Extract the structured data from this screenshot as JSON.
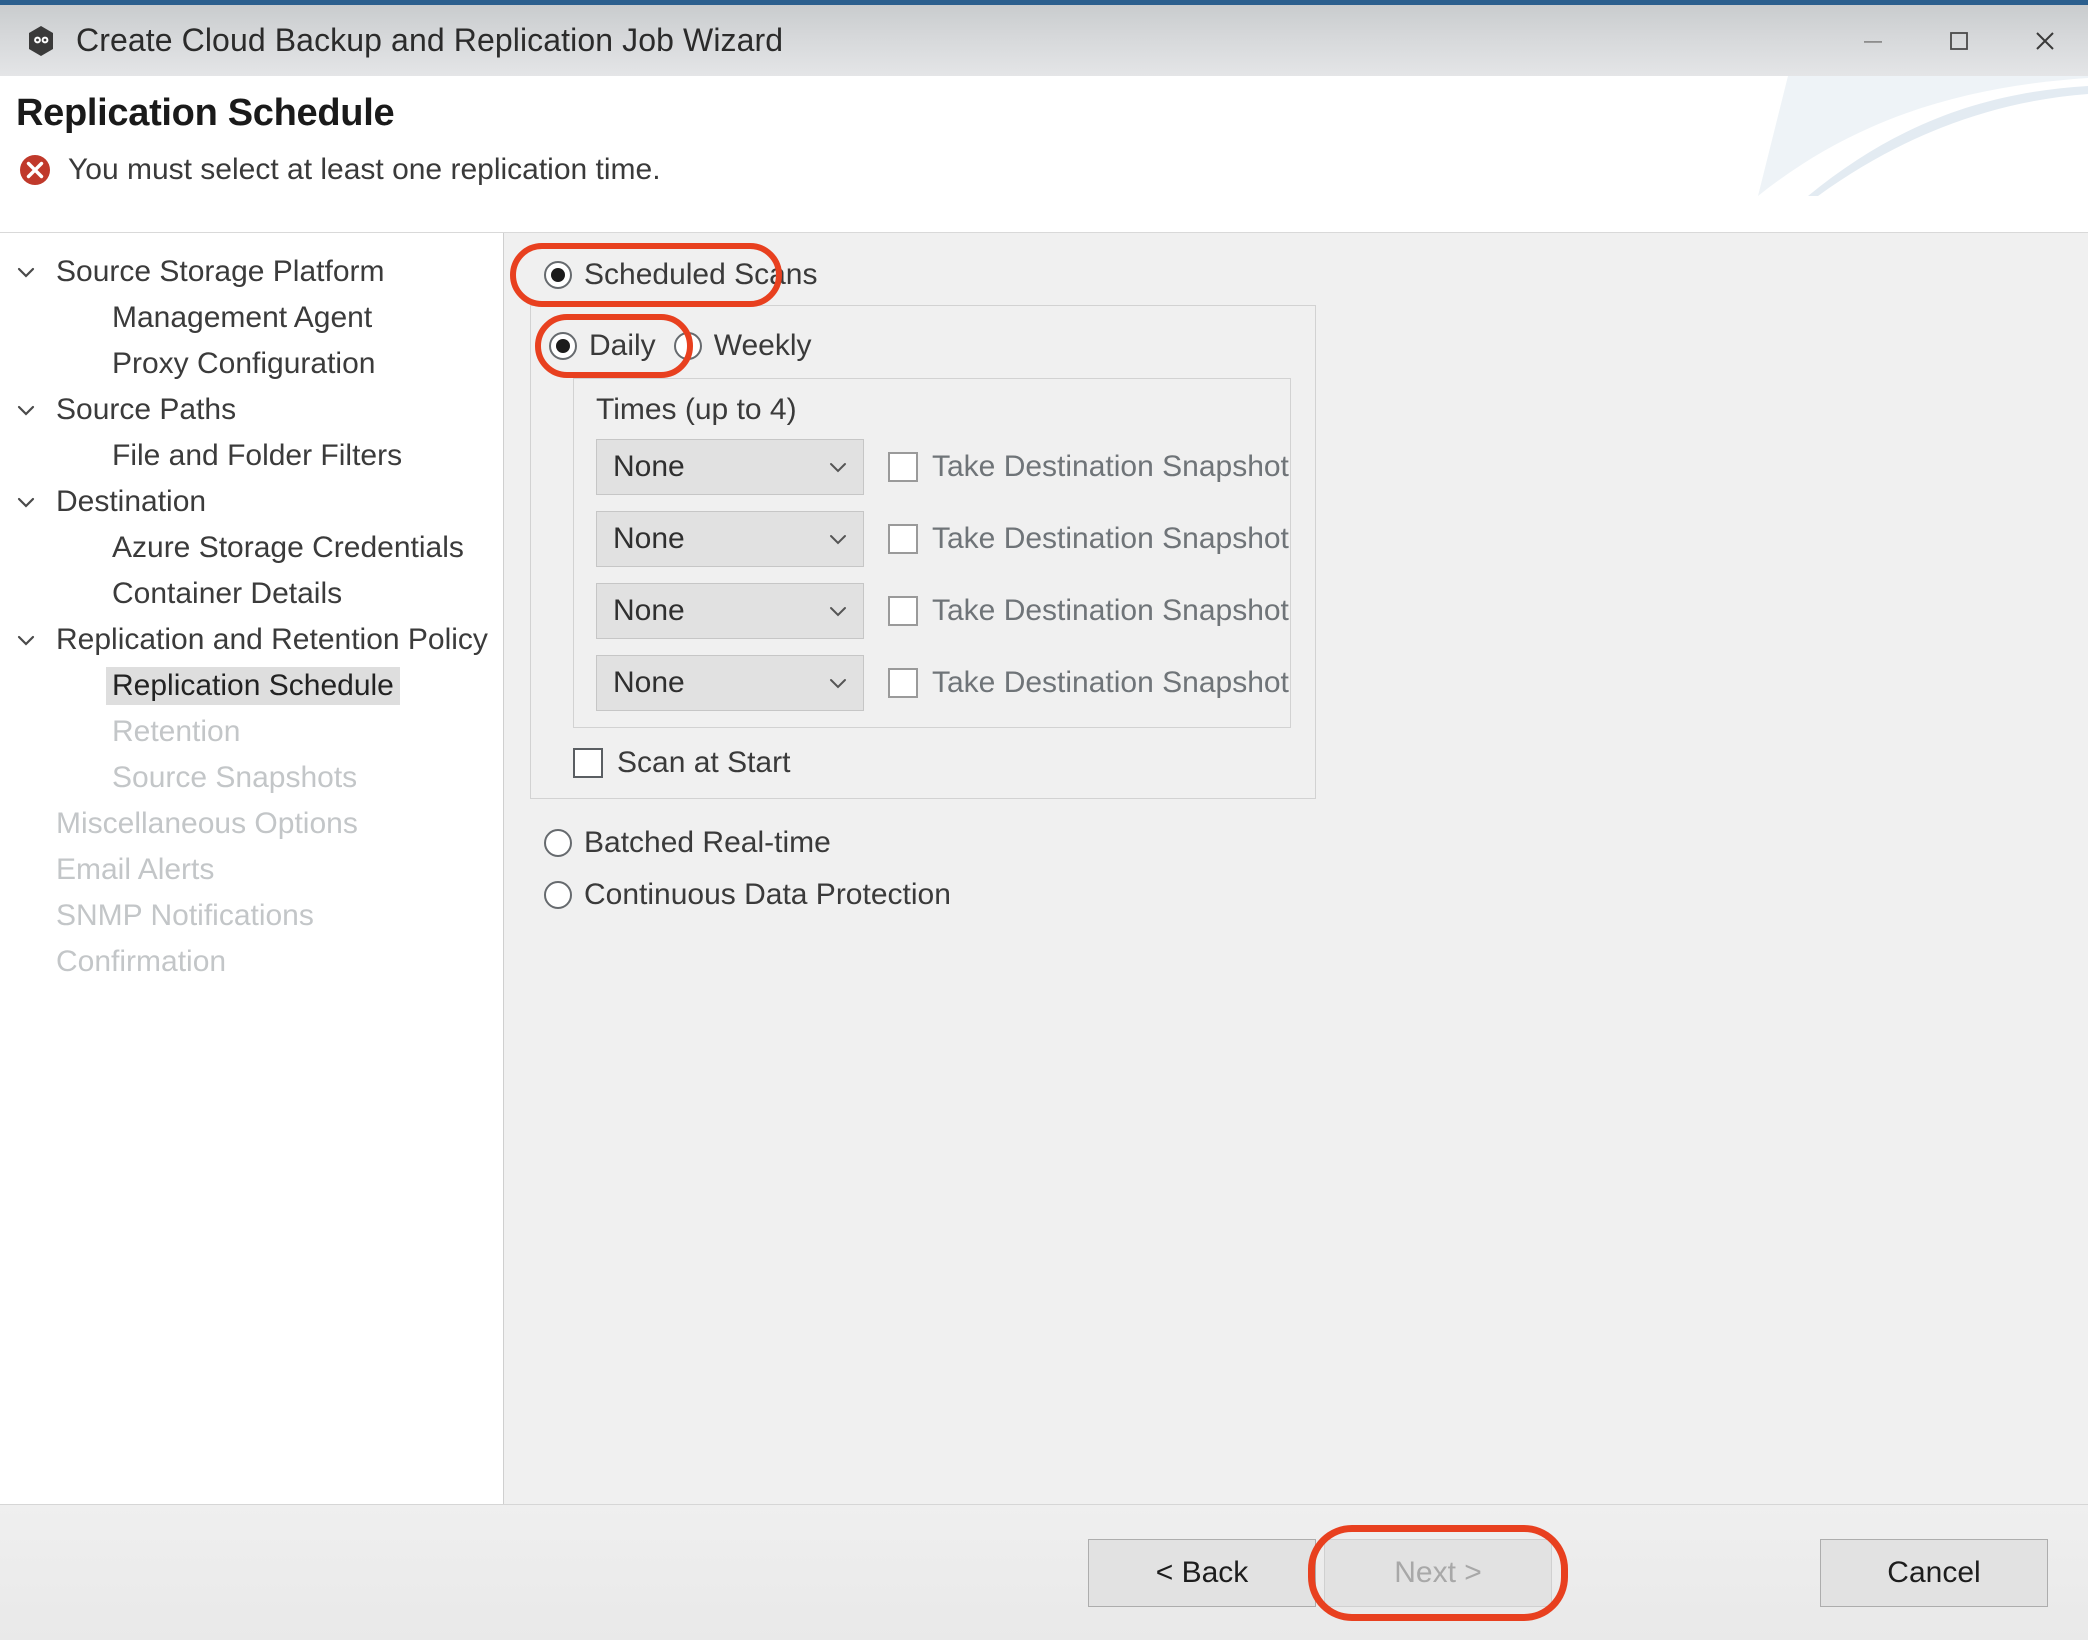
{
  "window": {
    "title": "Create Cloud Backup and Replication Job Wizard",
    "app_icon": "cloud-backup-icon",
    "controls": {
      "minimize": "minimize-icon",
      "maximize": "maximize-icon",
      "close": "close-icon"
    }
  },
  "header": {
    "page_title": "Replication Schedule",
    "error_icon": "error-circle-x-icon",
    "error_message": "You must select at least one replication time."
  },
  "sidebar": {
    "items": [
      {
        "label": "Source Storage Platform",
        "level": 0,
        "expandable": true,
        "state": "enabled"
      },
      {
        "label": "Management Agent",
        "level": 1,
        "expandable": false,
        "state": "enabled"
      },
      {
        "label": "Proxy Configuration",
        "level": 1,
        "expandable": false,
        "state": "enabled"
      },
      {
        "label": "Source Paths",
        "level": 0,
        "expandable": true,
        "state": "enabled"
      },
      {
        "label": "File and Folder Filters",
        "level": 1,
        "expandable": false,
        "state": "enabled"
      },
      {
        "label": "Destination",
        "level": 0,
        "expandable": true,
        "state": "enabled"
      },
      {
        "label": "Azure Storage Credentials",
        "level": 1,
        "expandable": false,
        "state": "enabled"
      },
      {
        "label": "Container Details",
        "level": 1,
        "expandable": false,
        "state": "enabled"
      },
      {
        "label": "Replication and Retention Policy",
        "level": 0,
        "expandable": true,
        "state": "enabled"
      },
      {
        "label": "Replication Schedule",
        "level": 1,
        "expandable": false,
        "state": "selected"
      },
      {
        "label": "Retention",
        "level": 1,
        "expandable": false,
        "state": "disabled"
      },
      {
        "label": "Source Snapshots",
        "level": 1,
        "expandable": false,
        "state": "disabled"
      },
      {
        "label": "Miscellaneous Options",
        "level": 0,
        "expandable": false,
        "state": "disabled"
      },
      {
        "label": "Email Alerts",
        "level": 0,
        "expandable": false,
        "state": "disabled"
      },
      {
        "label": "SNMP Notifications",
        "level": 0,
        "expandable": false,
        "state": "disabled"
      },
      {
        "label": "Confirmation",
        "level": 0,
        "expandable": false,
        "state": "disabled"
      }
    ]
  },
  "main": {
    "mode": {
      "scheduled_scans": "Scheduled Scans",
      "batched_realtime": "Batched Real-time",
      "continuous_data_protection": "Continuous Data Protection",
      "selected": "Scheduled Scans"
    },
    "frequency": {
      "daily": "Daily",
      "weekly": "Weekly",
      "selected": "Daily"
    },
    "times": {
      "title": "Times (up to 4)",
      "rows": [
        {
          "value": "None",
          "snapshot_label": "Take Destination Snapshot",
          "snapshot_checked": false
        },
        {
          "value": "None",
          "snapshot_label": "Take Destination Snapshot",
          "snapshot_checked": false
        },
        {
          "value": "None",
          "snapshot_label": "Take Destination Snapshot",
          "snapshot_checked": false
        },
        {
          "value": "None",
          "snapshot_label": "Take Destination Snapshot",
          "snapshot_checked": false
        }
      ]
    },
    "scan_at_start": {
      "label": "Scan at Start",
      "checked": false
    }
  },
  "footer": {
    "back": "< Back",
    "next": "Next >",
    "cancel": "Cancel",
    "next_enabled": false
  },
  "highlights": {
    "color": "#e8401f",
    "targets": [
      "Scheduled Scans",
      "Daily",
      "Next >"
    ]
  }
}
